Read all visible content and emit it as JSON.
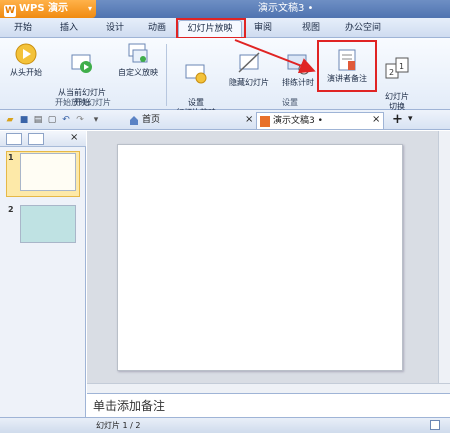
{
  "app": {
    "logo_letter": "W",
    "name": "WPS 演示",
    "dropdown": "▾",
    "doc_title": "演示文稿3 •"
  },
  "tabs": [
    "开始",
    "插入",
    "设计",
    "动画",
    "幻灯片放映",
    "审阅",
    "视图",
    "办公空间"
  ],
  "ribbon": {
    "group1": {
      "buttons": [
        "从头开始",
        "从当前幻灯片\n开始",
        "自定义放映"
      ],
      "label": "开始放映幻灯片"
    },
    "group2": {
      "buttons": [
        "设置\n幻灯片放映",
        "隐藏幻灯片",
        "排练计时",
        "演讲者备注",
        "幻灯片\n切换"
      ],
      "label": "设置"
    }
  },
  "doc_tabs": {
    "home": "首页",
    "doc": "演示文稿3 •",
    "add": "+",
    "close": "×"
  },
  "slides": [
    {
      "num": "1"
    },
    {
      "num": "2"
    }
  ],
  "slide_number_marker": "1",
  "notes_placeholder": "单击添加备注",
  "status": {
    "slide_counter": "幻灯片 1 / 2"
  },
  "colors": {
    "accent_orange": "#f08a10",
    "highlight_red": "#e02424",
    "ribbon_blue": "#4f73b0"
  }
}
